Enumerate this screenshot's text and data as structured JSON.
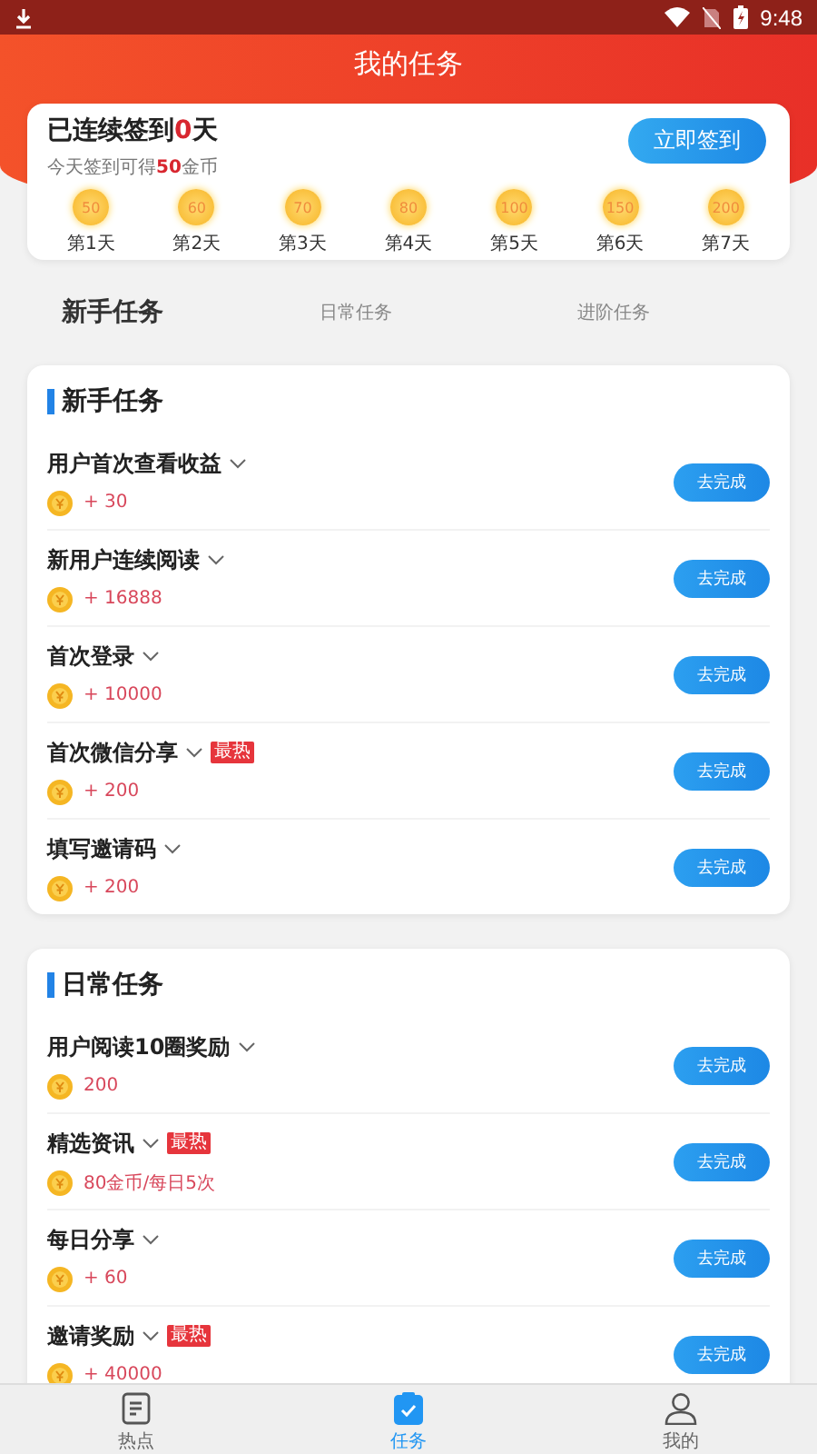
{
  "status_bar": {
    "time": "9:48"
  },
  "header": {
    "title": "我的任务"
  },
  "checkin": {
    "title": "已连续签到**0**天",
    "subtitle": "今天签到可得**50**金币",
    "button": "立即签到",
    "days": [
      {
        "reward": "50",
        "label": "第1天"
      },
      {
        "reward": "60",
        "label": "第2天"
      },
      {
        "reward": "70",
        "label": "第3天"
      },
      {
        "reward": "80",
        "label": "第4天"
      },
      {
        "reward": "100",
        "label": "第5天"
      },
      {
        "reward": "150",
        "label": "第6天"
      },
      {
        "reward": "200",
        "label": "第7天"
      }
    ]
  },
  "tabs": [
    {
      "label": "新手任务",
      "selected": true
    },
    {
      "label": "日常任务",
      "selected": false
    },
    {
      "label": "进阶任务",
      "selected": false
    }
  ],
  "sections": [
    {
      "title": "新手任务",
      "tasks": [
        {
          "name": "用户首次查看收益",
          "reward": "+ 30",
          "button": "去完成"
        },
        {
          "name": "新用户连续阅读",
          "reward": "+ 16888",
          "button": "去完成"
        },
        {
          "name": "首次登录",
          "reward": "+ 10000",
          "button": "去完成"
        },
        {
          "name": "首次微信分享",
          "badge": "最热",
          "reward": "+ 200",
          "button": "去完成"
        },
        {
          "name": "填写邀请码",
          "reward": "+ 200",
          "button": "去完成"
        }
      ]
    },
    {
      "title": "日常任务",
      "tasks": [
        {
          "name": "用户阅读10圈奖励",
          "reward": "200",
          "button": "去完成"
        },
        {
          "name": "精选资讯",
          "badge": "最热",
          "reward": "80金币/每日5次",
          "button": "去完成"
        },
        {
          "name": "每日分享",
          "reward": "+ 60",
          "button": "去完成"
        },
        {
          "name": "邀请奖励",
          "badge": "最热",
          "reward": "+ 40000",
          "button": "去完成"
        }
      ]
    }
  ],
  "bottom_nav": [
    {
      "label": "热点",
      "kind": "news",
      "selected": false
    },
    {
      "label": "任务",
      "kind": "tasks",
      "selected": true
    },
    {
      "label": "我的",
      "kind": "profile",
      "selected": false
    }
  ]
}
